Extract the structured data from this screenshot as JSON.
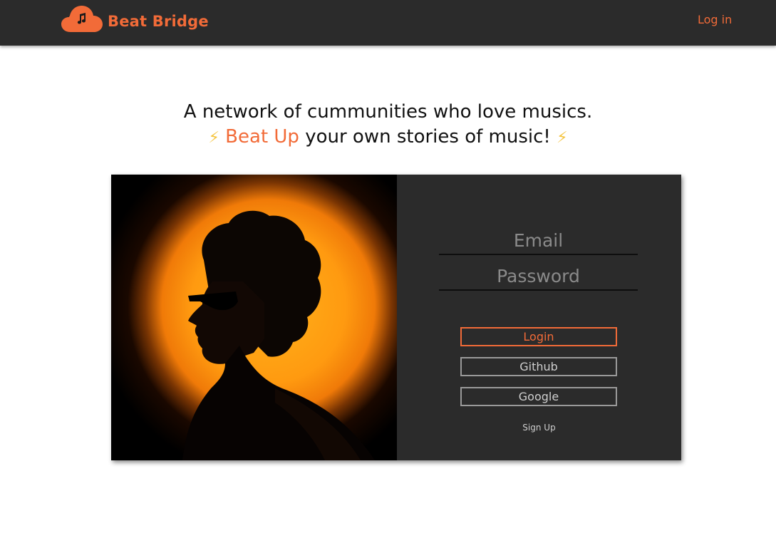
{
  "app": {
    "name": "Beat Bridge",
    "logo_icon": "cloud-music-note-icon",
    "accent_color": "#f26b38",
    "nav_bg_color": "#2b2b2b"
  },
  "navbar": {
    "login_link": "Log in"
  },
  "hero": {
    "line1": "A network of cummunities who love musics.",
    "bolt_left": "⚡",
    "accent": "Beat Up",
    "line2_rest": " your own stories of music! ",
    "bolt_right": "⚡"
  },
  "login_form": {
    "email_placeholder": "Email",
    "email_value": "",
    "password_placeholder": "Password",
    "password_value": "",
    "login_button": "Login",
    "github_button": "Github",
    "google_button": "Google",
    "signup_link": "Sign Up"
  }
}
